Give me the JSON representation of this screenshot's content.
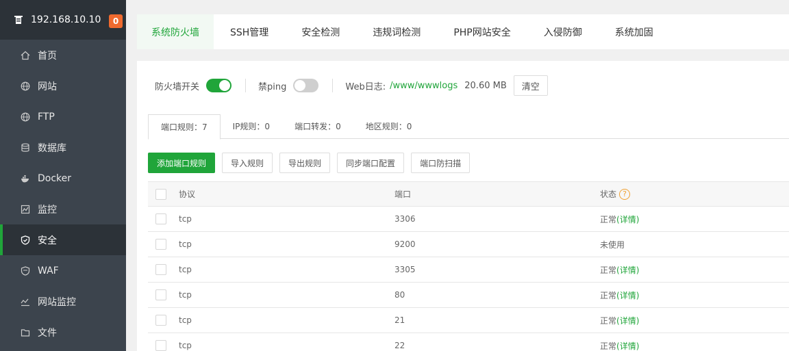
{
  "sidebar": {
    "ip": "192.168.10.10",
    "badge": "0",
    "items": [
      {
        "label": "首页",
        "icon": "home-icon"
      },
      {
        "label": "网站",
        "icon": "globe-icon"
      },
      {
        "label": "FTP",
        "icon": "ftp-globe-icon"
      },
      {
        "label": "数据库",
        "icon": "database-icon"
      },
      {
        "label": "Docker",
        "icon": "docker-icon"
      },
      {
        "label": "监控",
        "icon": "monitor-icon"
      },
      {
        "label": "安全",
        "icon": "shield-icon"
      },
      {
        "label": "WAF",
        "icon": "waf-shield-icon"
      },
      {
        "label": "网站监控",
        "icon": "chart-icon"
      },
      {
        "label": "文件",
        "icon": "folder-icon"
      }
    ]
  },
  "tabs": [
    "系统防火墙",
    "SSH管理",
    "安全检测",
    "违规词检测",
    "PHP网站安全",
    "入侵防御",
    "系统加固"
  ],
  "controls": {
    "firewall_label": "防火墙开关",
    "ping_label": "禁ping",
    "weblog_label": "Web日志:",
    "weblog_path": "/www/wwwlogs",
    "weblog_size": "20.60 MB",
    "clear_label": "清空"
  },
  "subtabs": [
    "端口规则：7",
    "IP规则：0",
    "端口转发：0",
    "地区规则：0"
  ],
  "actions": [
    "添加端口规则",
    "导入规则",
    "导出规则",
    "同步端口配置",
    "端口防扫描"
  ],
  "table": {
    "headers": [
      "协议",
      "端口",
      "状态"
    ],
    "help_mark": "?",
    "rows": [
      {
        "protocol": "tcp",
        "port": "3306",
        "status": "正常",
        "detail": "(详情)"
      },
      {
        "protocol": "tcp",
        "port": "9200",
        "status": "未使用",
        "detail": ""
      },
      {
        "protocol": "tcp",
        "port": "3305",
        "status": "正常",
        "detail": "(详情)"
      },
      {
        "protocol": "tcp",
        "port": "80",
        "status": "正常",
        "detail": "(详情)"
      },
      {
        "protocol": "tcp",
        "port": "21",
        "status": "正常",
        "detail": "(详情)"
      },
      {
        "protocol": "tcp",
        "port": "22",
        "status": "正常",
        "detail": "(详情)"
      }
    ]
  },
  "colors": {
    "accent": "#20a53a",
    "sidebar": "#3c444d",
    "badge": "#f06a2e"
  }
}
